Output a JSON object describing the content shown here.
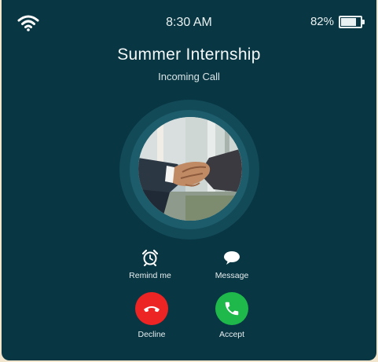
{
  "status_bar": {
    "time": "8:30 AM",
    "battery_percent_label": "82%",
    "battery_level": 0.82,
    "wifi_icon": "wifi-icon",
    "battery_icon": "battery-icon"
  },
  "call": {
    "caller_name": "Summer Internship",
    "status": "Incoming Call",
    "avatar_icon": "handshake-photo"
  },
  "actions": {
    "remind_label": "Remind me",
    "remind_icon": "alarm-clock-icon",
    "message_label": "Message",
    "message_icon": "chat-bubble-icon",
    "decline_label": "Decline",
    "decline_icon": "phone-hangup-icon",
    "accept_label": "Accept",
    "accept_icon": "phone-icon"
  },
  "colors": {
    "background": "#083642",
    "decline": "#ec2424",
    "accept": "#1eb94a"
  }
}
